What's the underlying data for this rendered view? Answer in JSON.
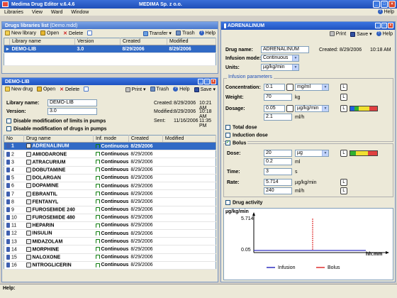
{
  "window": {
    "title": "Medima Drug Editor v.6.4.6",
    "company": "MEDIMA Sp. z o.o."
  },
  "menu": {
    "items": [
      "Libraries",
      "View",
      "Ward",
      "Window"
    ],
    "help": "Help"
  },
  "libraries_panel": {
    "title": "Drugs libraries list",
    "subtitle": "(Demo.mdd)",
    "toolbar": {
      "new": "New library",
      "open": "Open",
      "delete": "Delete",
      "transfer": "Transfer",
      "trash": "Trash",
      "help": "Help"
    },
    "columns": [
      "Library name",
      "Version",
      "Created",
      "Modified"
    ],
    "rows": [
      {
        "name": "DEMO-LIB",
        "version": "3.0",
        "created": "8/29/2006",
        "modified": "8/29/2006"
      }
    ]
  },
  "lib_panel": {
    "title": "DEMO-LIB",
    "toolbar": {
      "new": "New drug",
      "open": "Open",
      "delete": "Delete",
      "print": "Print",
      "trash": "Trash",
      "help": "Help",
      "save": "Save"
    },
    "library_name_label": "Library name:",
    "library_name": "DEMO-LIB",
    "version_label": "Version:",
    "version": "3.0",
    "created_label": "Created:",
    "created_date": "8/29/2006",
    "created_time": "10:21 AM",
    "modified_label": "Modified:",
    "modified_date": "8/29/2006",
    "modified_time": "10:18 AM",
    "sent_label": "Sent:",
    "sent_date": "11/16/2006",
    "sent_time": "11:35 PM",
    "check1": "Disable modification of limits in pumps",
    "check2": "Disable modification of drugs in pumps",
    "columns": [
      "No",
      "Drug name",
      "Inf. mode",
      "Created",
      "Modified"
    ],
    "drugs": [
      {
        "no": "1",
        "name": "ADRENALINUM",
        "mode": "Continuous",
        "created": "8/29/2006"
      },
      {
        "no": "2",
        "name": "AMIODARONE",
        "mode": "Continuous",
        "created": "8/29/2006"
      },
      {
        "no": "3",
        "name": "ATRACURIUM",
        "mode": "Continuous",
        "created": "8/29/2006"
      },
      {
        "no": "4",
        "name": "DOBUTAMINE",
        "mode": "Continuous",
        "created": "8/29/2006"
      },
      {
        "no": "5",
        "name": "DOLARGAN",
        "mode": "Continuous",
        "created": "8/29/2006"
      },
      {
        "no": "6",
        "name": "DOPAMINE",
        "mode": "Continuous",
        "created": "8/29/2006"
      },
      {
        "no": "7",
        "name": "EBRANTIL",
        "mode": "Continuous",
        "created": "8/29/2006"
      },
      {
        "no": "8",
        "name": "FENTANYL",
        "mode": "Continuous",
        "created": "8/29/2006"
      },
      {
        "no": "9",
        "name": "FUROSEMIDE 240",
        "mode": "Continuous",
        "created": "8/29/2006"
      },
      {
        "no": "10",
        "name": "FUROSEMIDE 480",
        "mode": "Continuous",
        "created": "8/29/2006"
      },
      {
        "no": "11",
        "name": "HEPARIN",
        "mode": "Continuous",
        "created": "8/29/2006"
      },
      {
        "no": "12",
        "name": "INSULIN",
        "mode": "Continuous",
        "created": "8/29/2006"
      },
      {
        "no": "13",
        "name": "MIDAZOLAM",
        "mode": "Continuous",
        "created": "8/29/2006"
      },
      {
        "no": "14",
        "name": "MORPHINE",
        "mode": "Continuous",
        "created": "8/29/2006"
      },
      {
        "no": "15",
        "name": "NALOXONE",
        "mode": "Continuous",
        "created": "8/29/2006"
      },
      {
        "no": "16",
        "name": "NITROGLICERIN",
        "mode": "Continuous",
        "created": "8/29/2006"
      }
    ]
  },
  "drug_panel": {
    "title": "ADRENALINUM",
    "toolbar": {
      "print": "Print",
      "save": "Save",
      "help": "Help"
    },
    "drug_name_label": "Drug name:",
    "drug_name": "ADRENALINUM",
    "created_label": "Created:",
    "created_date": "8/29/2006",
    "created_time": "10:18 AM",
    "infusion_mode_label": "Infusion mode:",
    "infusion_mode": "Continuous",
    "units_label": "Units:",
    "units": "µg/kg/min",
    "params_group": "Infusion parameters",
    "concentration_label": "Concentration:",
    "concentration": "0.1",
    "concentration_unit": "mg/ml",
    "weight_label": "Weight:",
    "weight": "70",
    "weight_unit": "kg",
    "dosage_label": "Dosage:",
    "dosage": "0.05",
    "dosage_unit": "µg/kg/min",
    "dosage_rate": "2.1",
    "dosage_rate_unit": "ml/h",
    "total_dose": "Total dose",
    "induction_dose": "Induction dose",
    "bolus": "Bolus",
    "dose_label": "Dose:",
    "dose": "20",
    "dose_unit": "µg",
    "dose_ml": "0.2",
    "dose_ml_unit": "ml",
    "time_label": "Time:",
    "time": "3",
    "time_unit": "s",
    "rate_label": "Rate:",
    "rate": "5.714",
    "rate_unit": "µg/kg/min",
    "rate_ml": "240",
    "rate_ml_unit": "ml/h",
    "drug_activity": "Drug activity",
    "limit_label": "L",
    "graph": {
      "y_label": "µg/kg/min",
      "y_top": "5.714",
      "y_base": "0.05",
      "x_label": "hh:mm",
      "legend": [
        "Infusion",
        "Bolus"
      ],
      "infusion_color": "#3030c0",
      "bolus_color": "#e03030"
    }
  },
  "status": {
    "help": "Help:"
  }
}
